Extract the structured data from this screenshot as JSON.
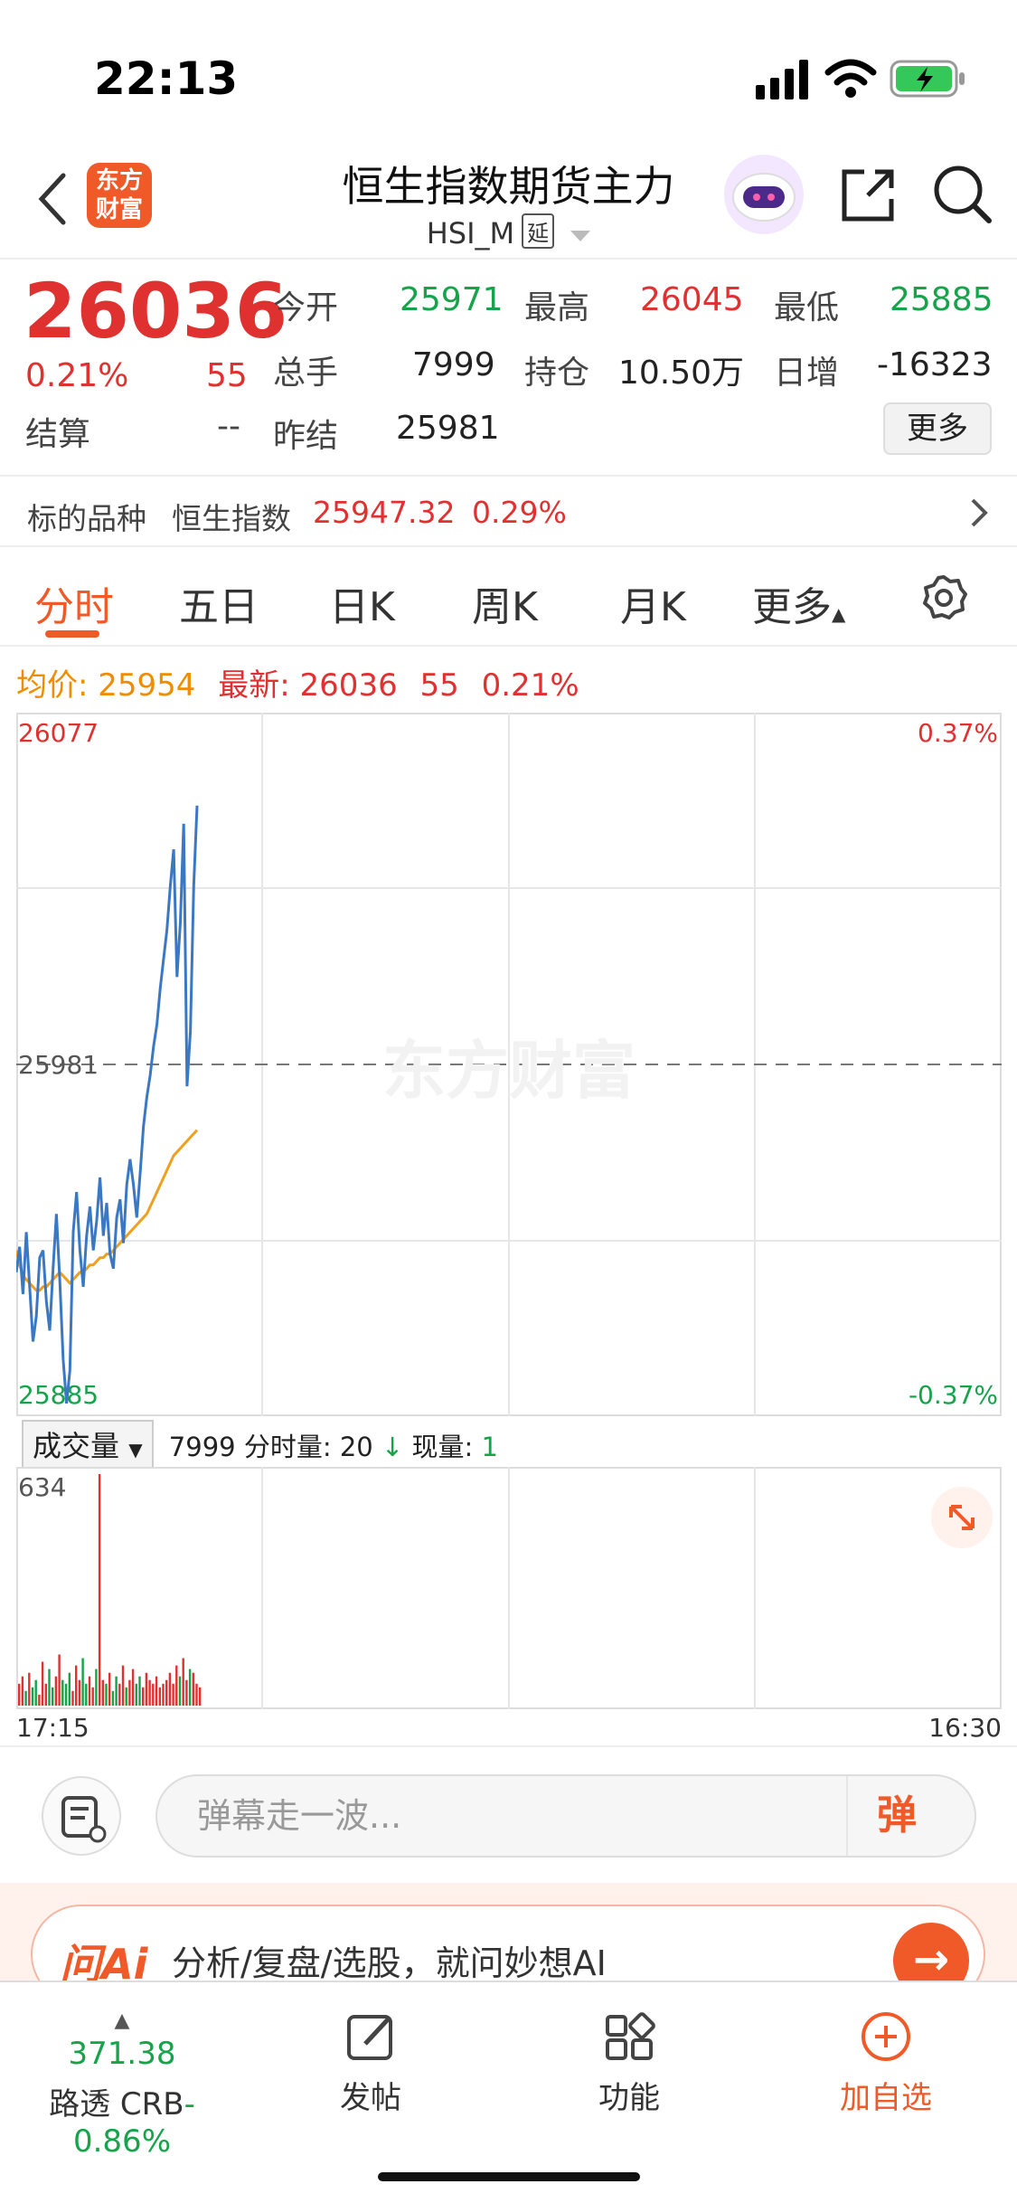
{
  "status_bar": {
    "time": "22:13"
  },
  "nav": {
    "logo_text_line1": "东方",
    "logo_text_line2": "财富",
    "title": "恒生指数期货主力",
    "subtitle": "HSI_M",
    "delay_badge": "延"
  },
  "quote": {
    "price": "26036",
    "change_pct": "0.21%",
    "change": "55",
    "open_label": "今开",
    "open": "25971",
    "high_label": "最高",
    "high": "26045",
    "low_label": "最低",
    "low": "25885",
    "volume_label": "总手",
    "volume": "7999",
    "oi_label": "持仓",
    "oi": "10.50万",
    "daily_inc_label": "日增",
    "daily_inc": "-16323",
    "settle_label": "结算",
    "settle": "--",
    "prev_settle_label": "昨结",
    "prev_settle": "25981",
    "more_label": "更多"
  },
  "underlying": {
    "label": "标的品种",
    "name": "恒生指数",
    "price": "25947.32",
    "change_pct": "0.29%"
  },
  "tabs": [
    {
      "label": "分时",
      "active": true
    },
    {
      "label": "五日"
    },
    {
      "label": "日K"
    },
    {
      "label": "周K"
    },
    {
      "label": "月K"
    },
    {
      "label": "更多"
    }
  ],
  "legend": {
    "avg_label": "均价:",
    "avg": "25954",
    "last_label": "最新:",
    "last": "26036",
    "last_change": "55",
    "last_pct": "0.21%"
  },
  "chart_labels": {
    "top_price": "26077",
    "top_pct": "0.37%",
    "mid_price": "25981",
    "bottom_price": "25885",
    "bottom_pct": "-0.37%",
    "watermark": "东方财富"
  },
  "volume": {
    "selector": "成交量",
    "total": "7999",
    "tick_label": "分时量: 20",
    "now_label": "现量:",
    "now": "1",
    "max_label": "634"
  },
  "time_axis": {
    "start": "17:15",
    "end": "16:30"
  },
  "danmu": {
    "placeholder": "弹幕走一波...",
    "send": "弹"
  },
  "ai_banner": {
    "logo": "问Ai",
    "text": "分析/复盘/选股，就问妙想AI"
  },
  "bottom_bar": {
    "ticker_value": "371.38",
    "ticker_name": "路透 CRB",
    "ticker_pct": "-0.86%",
    "post_label": "发帖",
    "function_label": "功能",
    "add_label": "加自选"
  },
  "colors": {
    "up": "#e03131",
    "down": "#16a34a",
    "brand": "#f05a28",
    "price_line": "#3b78c4",
    "avg_line": "#f0a020"
  },
  "chart_data": {
    "type": "line",
    "ylim": [
      25885,
      26077
    ],
    "reference": 25981,
    "series": [
      {
        "values": [
          25924,
          25931,
          25918,
          25935,
          25920,
          25905,
          25912,
          25928,
          25930,
          25916,
          25908,
          25925,
          25940,
          25922,
          25900,
          25888,
          25897,
          25935,
          25946,
          25930,
          25920,
          25934,
          25942,
          25930,
          25938,
          25950,
          25934,
          25943,
          25929,
          25925,
          25939,
          25944,
          25932,
          25948,
          25955,
          25948,
          25939,
          25951,
          25964,
          25972,
          25978,
          25986,
          25992,
          26002,
          26010,
          26018,
          26030,
          26040,
          26005,
          26020,
          26047,
          25975,
          25990,
          26030,
          26052
        ]
      },
      {
        "values": [
          25930,
          25926,
          25923,
          25922,
          25921,
          25920,
          25919,
          25919,
          25920,
          25920,
          25921,
          25922,
          25923,
          25924,
          25923,
          25922,
          25921,
          25922,
          25923,
          25924,
          25924,
          25925,
          25926,
          25926,
          25927,
          25928,
          25928,
          25929,
          25929,
          25930,
          25931,
          25932,
          25933,
          25934,
          25935,
          25936,
          25937,
          25938,
          25939,
          25940,
          25942,
          25944,
          25946,
          25948,
          25950,
          25952,
          25954,
          25956,
          25957,
          25958,
          25959,
          25960,
          25961,
          25962,
          25963
        ]
      }
    ],
    "volume": [
      60,
      80,
      40,
      90,
      50,
      70,
      30,
      120,
      60,
      100,
      50,
      80,
      140,
      70,
      60,
      90,
      40,
      110,
      70,
      130,
      60,
      80,
      50,
      100,
      634,
      70,
      60,
      90,
      40,
      80,
      60,
      110,
      50,
      70,
      100,
      60,
      80,
      50,
      90,
      70,
      60,
      80,
      50,
      60,
      70,
      90,
      60,
      110,
      80,
      130,
      70,
      100,
      90,
      60,
      50
    ]
  }
}
